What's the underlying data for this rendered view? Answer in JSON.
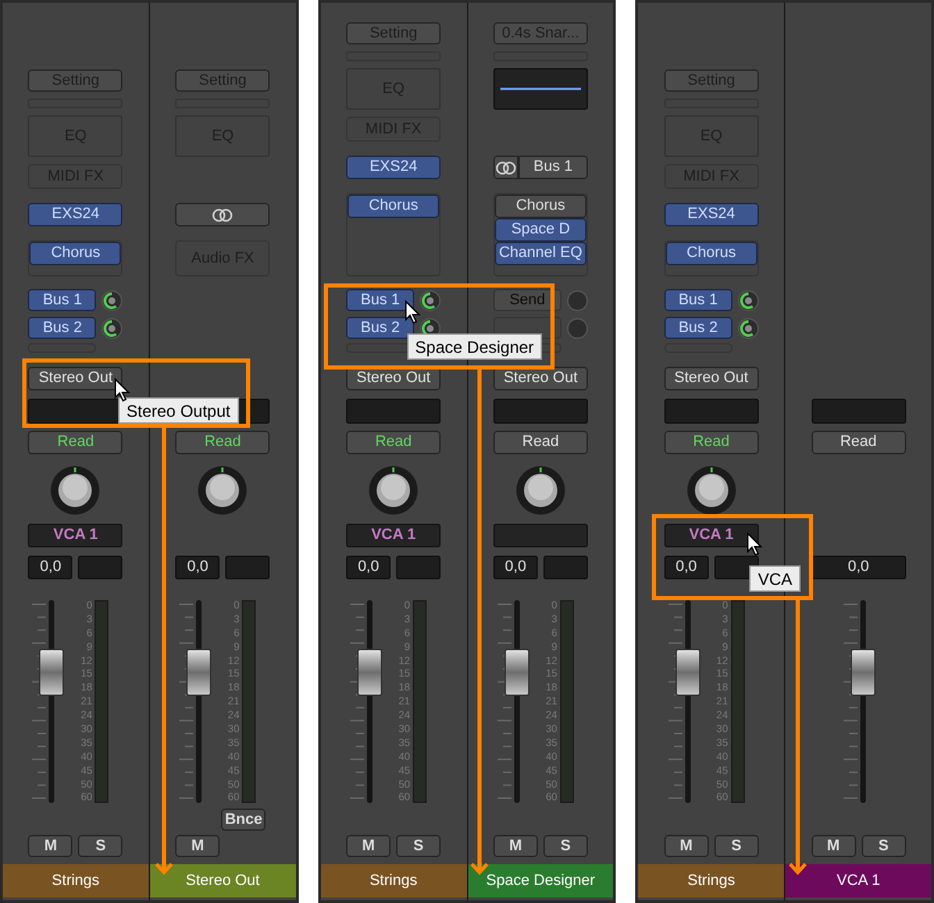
{
  "panels": [
    {
      "tooltip": "Stereo Output",
      "strips": [
        {
          "kind": "audio",
          "setting": "Setting",
          "eq": "EQ",
          "midi_fx": "MIDI FX",
          "input": "EXS24",
          "audio_fx": [
            {
              "label": "Chorus",
              "on": true
            }
          ],
          "sends": [
            {
              "label": "Bus 1",
              "on": true
            },
            {
              "label": "Bus 2",
              "on": true
            }
          ],
          "output": "Stereo Out",
          "automation": {
            "label": "Read",
            "on": true
          },
          "vca": "VCA 1",
          "volume": "0,0",
          "fader": {
            "level": 0.69
          },
          "meter_scale": [
            "0",
            "3",
            "6",
            "9",
            "12",
            "15",
            "18",
            "21",
            "24",
            "30",
            "35",
            "40",
            "45",
            "50",
            "60"
          ],
          "mute": "M",
          "solo": "S",
          "name": "Strings",
          "color": "#7a5322"
        },
        {
          "kind": "output",
          "setting": "Setting",
          "eq": "EQ",
          "audio_fx_placeholder": "Audio FX",
          "automation": {
            "label": "Read",
            "on": true
          },
          "volume": "0,0",
          "fader": {
            "level": 0.69
          },
          "meter_scale": [
            "0",
            "3",
            "6",
            "9",
            "12",
            "15",
            "18",
            "21",
            "24",
            "30",
            "35",
            "40",
            "45",
            "50",
            "60"
          ],
          "bounce": "Bnce",
          "mute": "M",
          "name": "Stereo Out",
          "color": "#6b8424"
        }
      ]
    },
    {
      "tooltip": "Space Designer",
      "strips": [
        {
          "kind": "audio",
          "setting": "Setting",
          "eq": "EQ",
          "midi_fx": "MIDI FX",
          "input": "EXS24",
          "audio_fx": [
            {
              "label": "Chorus",
              "on": true
            }
          ],
          "sends": [
            {
              "label": "Bus 1",
              "on": true
            },
            {
              "label": "Bus 2",
              "on": true
            }
          ],
          "output": "Stereo Out",
          "automation": {
            "label": "Read",
            "on": true
          },
          "vca": "VCA 1",
          "volume": "0,0",
          "fader": {
            "level": 0.69
          },
          "meter_scale": [
            "0",
            "3",
            "6",
            "9",
            "12",
            "15",
            "18",
            "21",
            "24",
            "30",
            "35",
            "40",
            "45",
            "50",
            "60"
          ],
          "mute": "M",
          "solo": "S",
          "name": "Strings",
          "color": "#7a5322"
        },
        {
          "kind": "aux",
          "setting": "0.4s Snar...",
          "input": "Bus 1",
          "audio_fx": [
            {
              "label": "Chorus",
              "on": false
            },
            {
              "label": "Space D",
              "on": true
            },
            {
              "label": "Channel EQ",
              "on": true
            }
          ],
          "sends": [
            {
              "label": "Send",
              "on": false
            }
          ],
          "output": "Stereo Out",
          "automation": {
            "label": "Read",
            "on": false
          },
          "volume": "0,0",
          "fader": {
            "level": 0.69
          },
          "meter_scale": [
            "0",
            "3",
            "6",
            "9",
            "12",
            "15",
            "18",
            "21",
            "24",
            "30",
            "35",
            "40",
            "45",
            "50",
            "60"
          ],
          "mute": "M",
          "solo": "S",
          "name": "Space Designer",
          "color": "#2a7d2e"
        }
      ]
    },
    {
      "tooltip": "VCA",
      "strips": [
        {
          "kind": "audio",
          "setting": "Setting",
          "eq": "EQ",
          "midi_fx": "MIDI FX",
          "input": "EXS24",
          "audio_fx": [
            {
              "label": "Chorus",
              "on": true
            }
          ],
          "sends": [
            {
              "label": "Bus 1",
              "on": true
            },
            {
              "label": "Bus 2",
              "on": true
            }
          ],
          "output": "Stereo Out",
          "automation": {
            "label": "Read",
            "on": true
          },
          "vca": "VCA 1",
          "volume": "0,0",
          "fader": {
            "level": 0.69
          },
          "meter_scale": [
            "0",
            "3",
            "6",
            "9",
            "12",
            "15",
            "18",
            "21",
            "24",
            "30",
            "35",
            "40",
            "45",
            "50",
            "60"
          ],
          "mute": "M",
          "solo": "S",
          "name": "Strings",
          "color": "#7a5322"
        },
        {
          "kind": "vca",
          "automation": {
            "label": "Read",
            "on": false
          },
          "volume": "0,0",
          "fader": {
            "level": 0.69
          },
          "mute": "M",
          "solo": "S",
          "name": "VCA 1",
          "color": "#6e0a5c"
        }
      ]
    }
  ]
}
